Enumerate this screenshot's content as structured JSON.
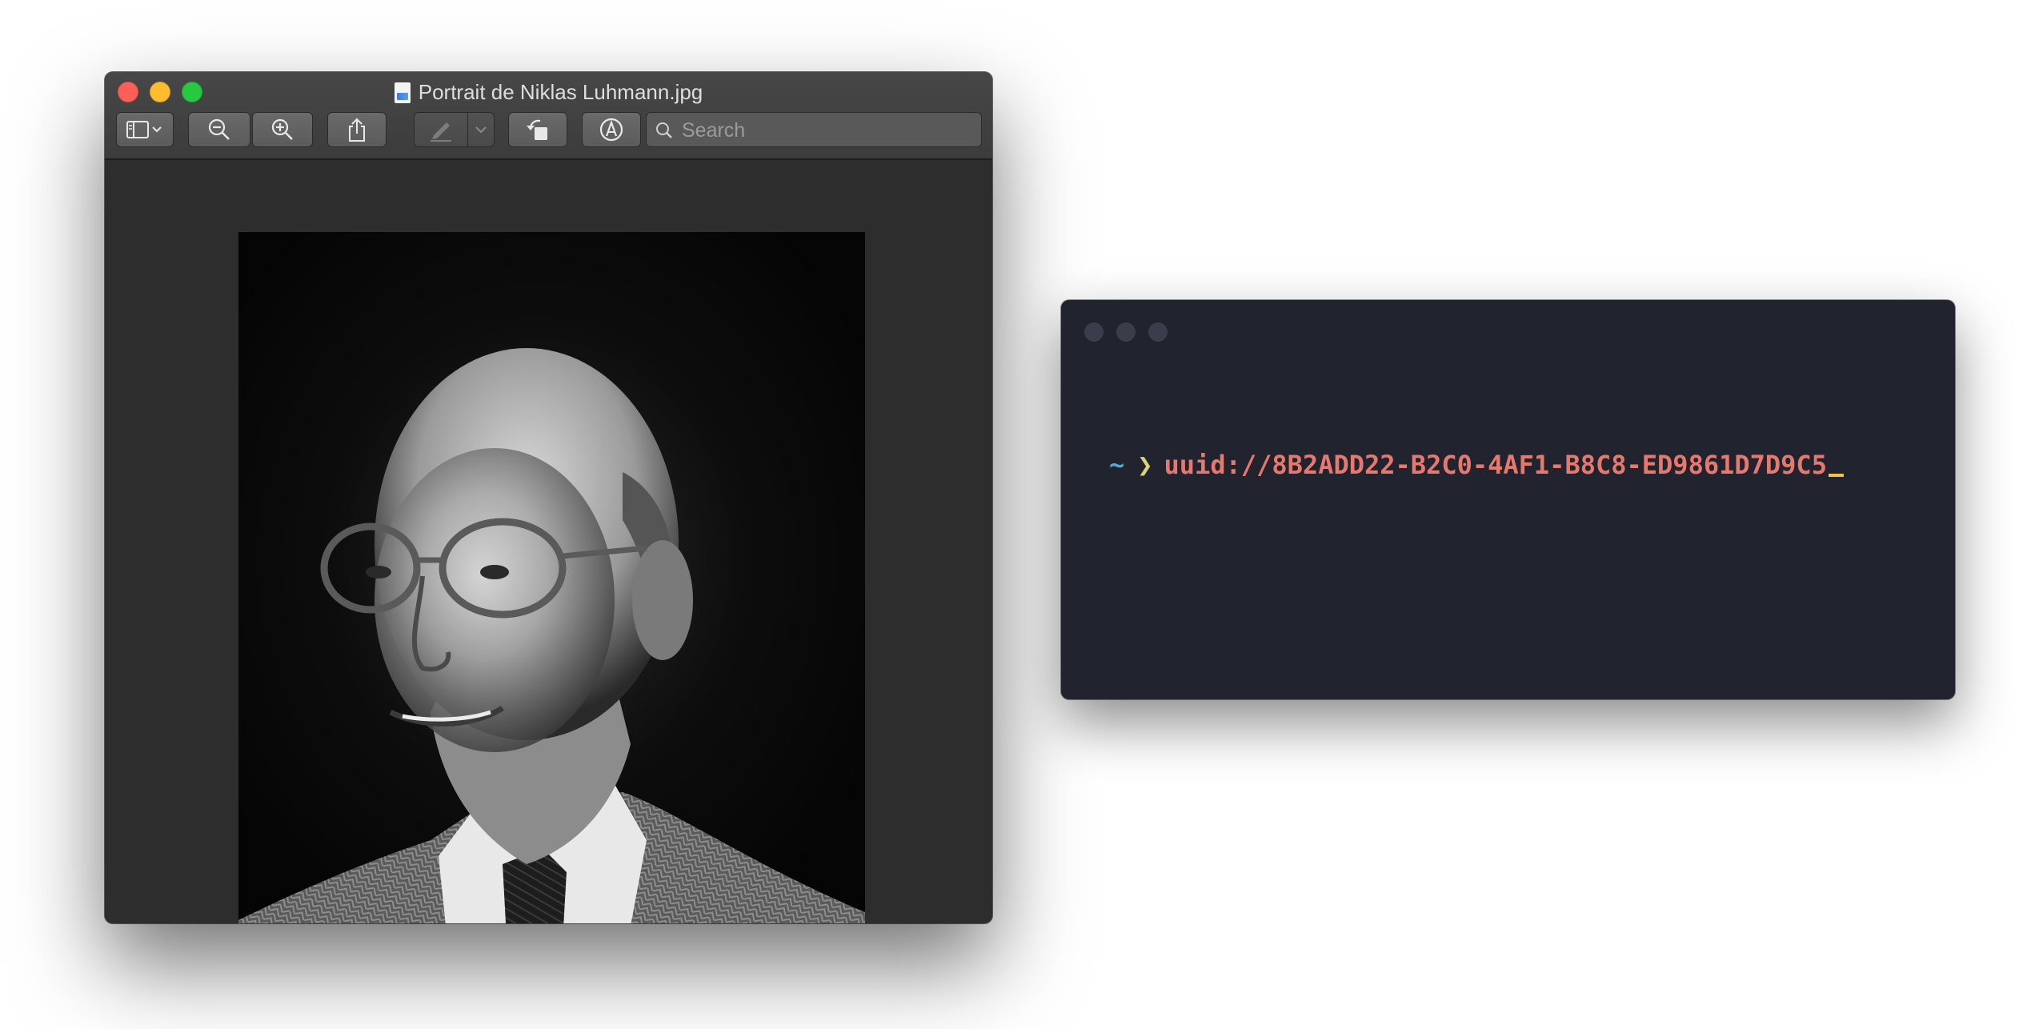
{
  "preview_window": {
    "title": "Portrait de Niklas Luhmann.jpg",
    "file_icon": "jpeg-document-icon",
    "toolbar": {
      "sidebar_toggle_icon": "sidebar-icon",
      "zoom_out_icon": "zoom-out-icon",
      "zoom_in_icon": "zoom-in-icon",
      "share_icon": "share-icon",
      "markup_pen_icon": "pen-icon",
      "rotate_icon": "rotate-left-icon",
      "annotate_icon": "markup-icon",
      "search_placeholder": "Search",
      "search_value": ""
    },
    "image_alt": "Black and white portrait of an older man wearing glasses and a herringbone tweed jacket"
  },
  "terminal_window": {
    "prompt_dir": "~",
    "prompt_symbol": "❯",
    "command": "uuid://8B2ADD22-B2C0-4AF1-B8C8-ED9861D7D9C5"
  },
  "colors": {
    "terminal_bg": "#21232e",
    "prompt_dir": "#58a6d6",
    "prompt_symbol": "#d8d575",
    "command": "#e6786e",
    "cursor": "#f0c34a"
  }
}
